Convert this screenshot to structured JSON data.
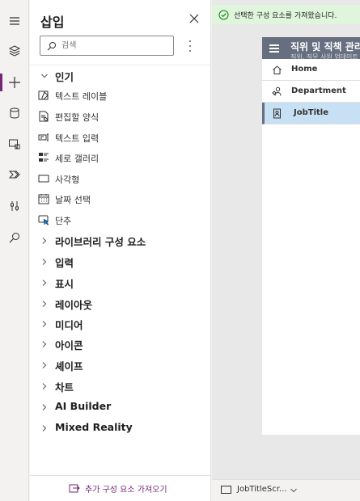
{
  "rail": {
    "items": [
      {
        "name": "hamburger-menu-icon"
      },
      {
        "name": "layers-icon"
      },
      {
        "name": "insert-plus-icon"
      },
      {
        "name": "data-cylinder-icon"
      },
      {
        "name": "media-icon"
      },
      {
        "name": "power-automate-icon"
      },
      {
        "name": "advanced-tools-icon"
      },
      {
        "name": "search-icon"
      }
    ]
  },
  "insert_panel": {
    "title": "삽입",
    "search_placeholder": "검색",
    "popular_label": "인기",
    "popular_items": [
      {
        "label": "텍스트 레이블",
        "icon": "text-label-icon"
      },
      {
        "label": "편집할 양식",
        "icon": "edit-form-icon"
      },
      {
        "label": "텍스트 입력",
        "icon": "text-input-icon"
      },
      {
        "label": "세로 갤러리",
        "icon": "vertical-gallery-icon"
      },
      {
        "label": "사각형",
        "icon": "rectangle-icon"
      },
      {
        "label": "날짜 선택",
        "icon": "date-picker-icon"
      },
      {
        "label": "단추",
        "icon": "button-icon"
      }
    ],
    "categories": [
      "라이브러리 구성 요소",
      "입력",
      "표시",
      "레이아웃",
      "미디어",
      "아이콘",
      "셰이프",
      "차트",
      "AI Builder",
      "Mixed Reality"
    ],
    "footer_label": "추가 구성 요소 가져오기"
  },
  "toast": {
    "message": "선택한 구성 요소를 가져왔습니다."
  },
  "screen": {
    "header_title": "직위 및 직책 관리",
    "header_subtitle": "직위, 직무 사원 업데이트",
    "nav_items": [
      {
        "label": "Home",
        "icon": "home-icon",
        "selected": false
      },
      {
        "label": "Department",
        "icon": "department-icon",
        "selected": false
      },
      {
        "label": "JobTitle",
        "icon": "jobtitle-icon",
        "selected": true
      }
    ]
  },
  "bottom_bar": {
    "screen_name": "JobTitleScr..."
  },
  "colors": {
    "accent": "#742774",
    "toast_bg": "#dff6dd",
    "toast_icon": "#107c10",
    "screen_header": "#666f80",
    "nav_selected": "#c7e0f4"
  }
}
